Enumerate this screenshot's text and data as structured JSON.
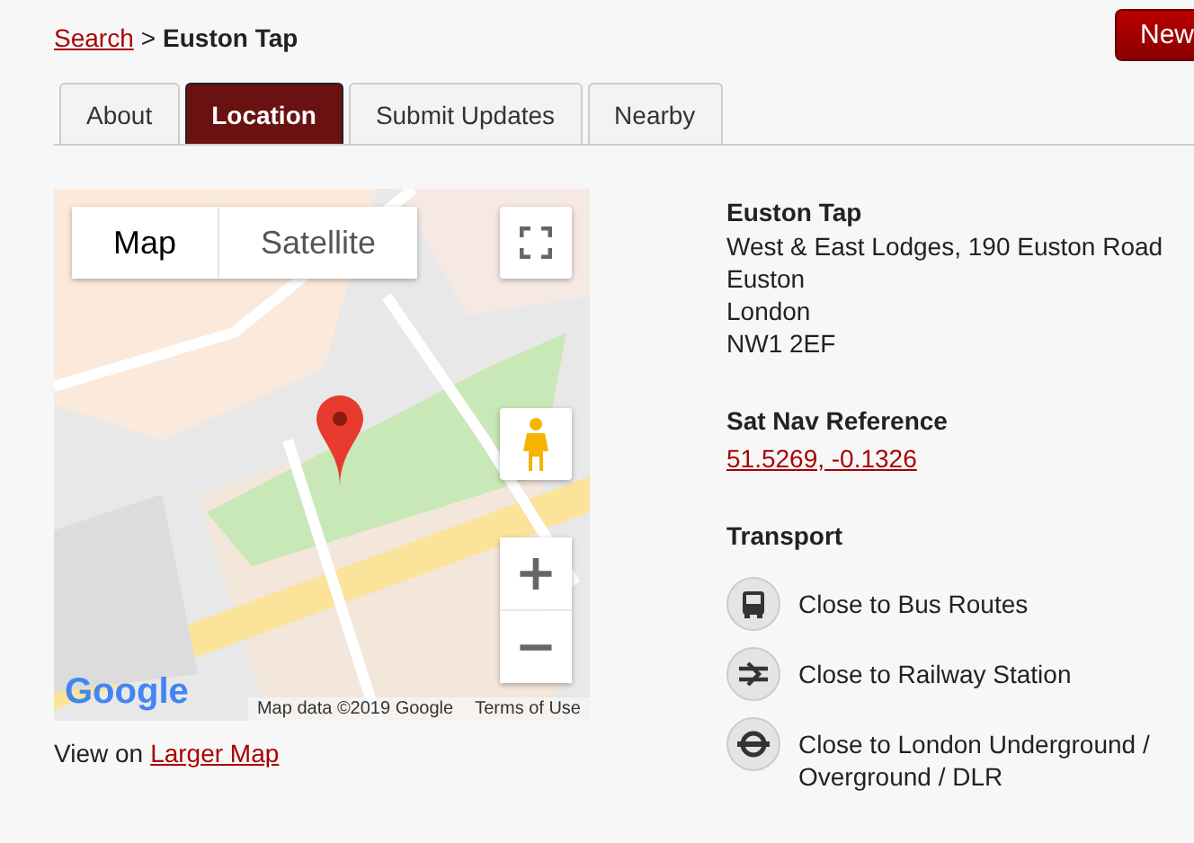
{
  "breadcrumb": {
    "link": "Search",
    "separator": ">",
    "current": "Euston Tap"
  },
  "header_button": "New",
  "tabs": [
    {
      "label": "About",
      "selected": false
    },
    {
      "label": "Location",
      "selected": true
    },
    {
      "label": "Submit Updates",
      "selected": false
    },
    {
      "label": "Nearby",
      "selected": false
    }
  ],
  "map": {
    "kind": "picture",
    "map_types": [
      {
        "label": "Map",
        "selected": true
      },
      {
        "label": "Satellite",
        "selected": false
      }
    ],
    "zoom_in": "+",
    "zoom_out": "−",
    "logo": "Google",
    "attribution": "Map data ©2019 Google",
    "terms": "Terms of Use"
  },
  "larger_map": {
    "prefix": "View on",
    "link": "Larger Map"
  },
  "address": {
    "name": "Euston Tap",
    "lines": [
      "West & East Lodges, 190 Euston Road",
      "Euston",
      "London",
      "NW1 2EF"
    ]
  },
  "sat_nav": {
    "heading": "Sat Nav Reference",
    "link": "51.5269, -0.1326"
  },
  "transport": {
    "heading": "Transport",
    "items": [
      {
        "kind": "bus",
        "label": "Close to Bus Routes"
      },
      {
        "kind": "rail",
        "label": "Close to Railway Station"
      },
      {
        "kind": "underground",
        "label": "Close to London Underground / Overground / DLR"
      }
    ]
  }
}
